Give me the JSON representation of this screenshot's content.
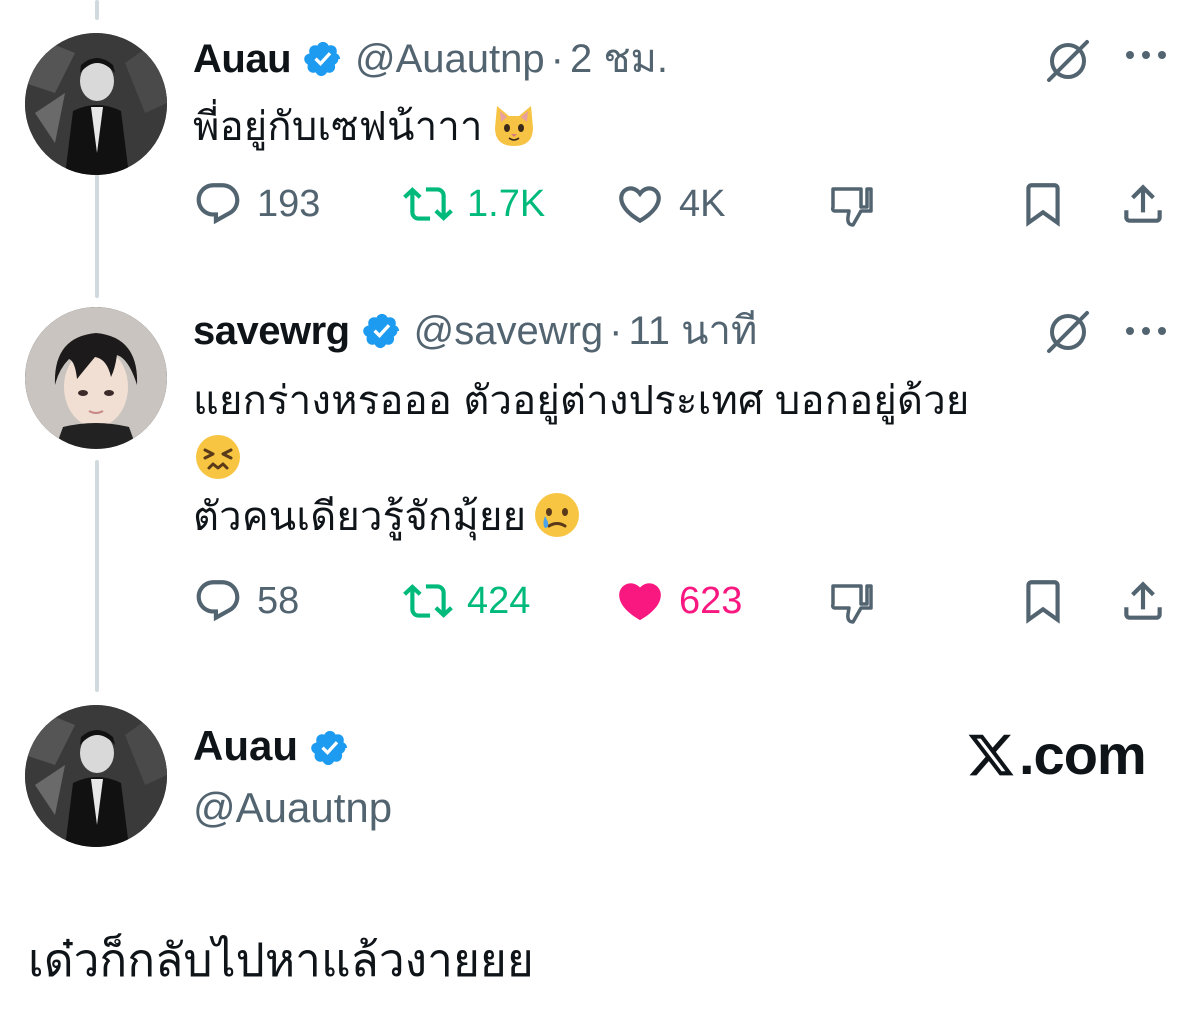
{
  "tweets": [
    {
      "name": "Auau",
      "handle": "@Auautnp",
      "separator": "·",
      "time": "2 ชม.",
      "text_lines": [
        "พี่อยู่กับเซฟน้าาา"
      ],
      "emoji": "cat-face",
      "replies": "193",
      "retweets": "1.7K",
      "likes": "4K",
      "liked": false
    },
    {
      "name": "savewrg",
      "handle": "@savewrg",
      "separator": "·",
      "time": "11 นาที",
      "text_lines": [
        "แยกร่างหรอออ ตัวอยู่ต่างประเทศ บอกอยู่ด้วย",
        "",
        "ตัวคนเดียวรู้จักมุ้ยย"
      ],
      "emoji": [
        "confounded-face",
        "face-holding-back-tears"
      ],
      "replies": "58",
      "retweets": "424",
      "likes": "623",
      "liked": true
    }
  ],
  "profile_card": {
    "name": "Auau",
    "handle": "@Auautnp",
    "site": ".com",
    "site_logo": "x-logo"
  },
  "caption": "เด๋วก็กลับไปหาแล้วงายยย",
  "colors": {
    "verified_blue": "#1d9bf0",
    "retweet_green": "#00ba7c",
    "like_pink": "#f91880",
    "secondary_text": "#536471",
    "thread_line": "#cfd9de"
  }
}
